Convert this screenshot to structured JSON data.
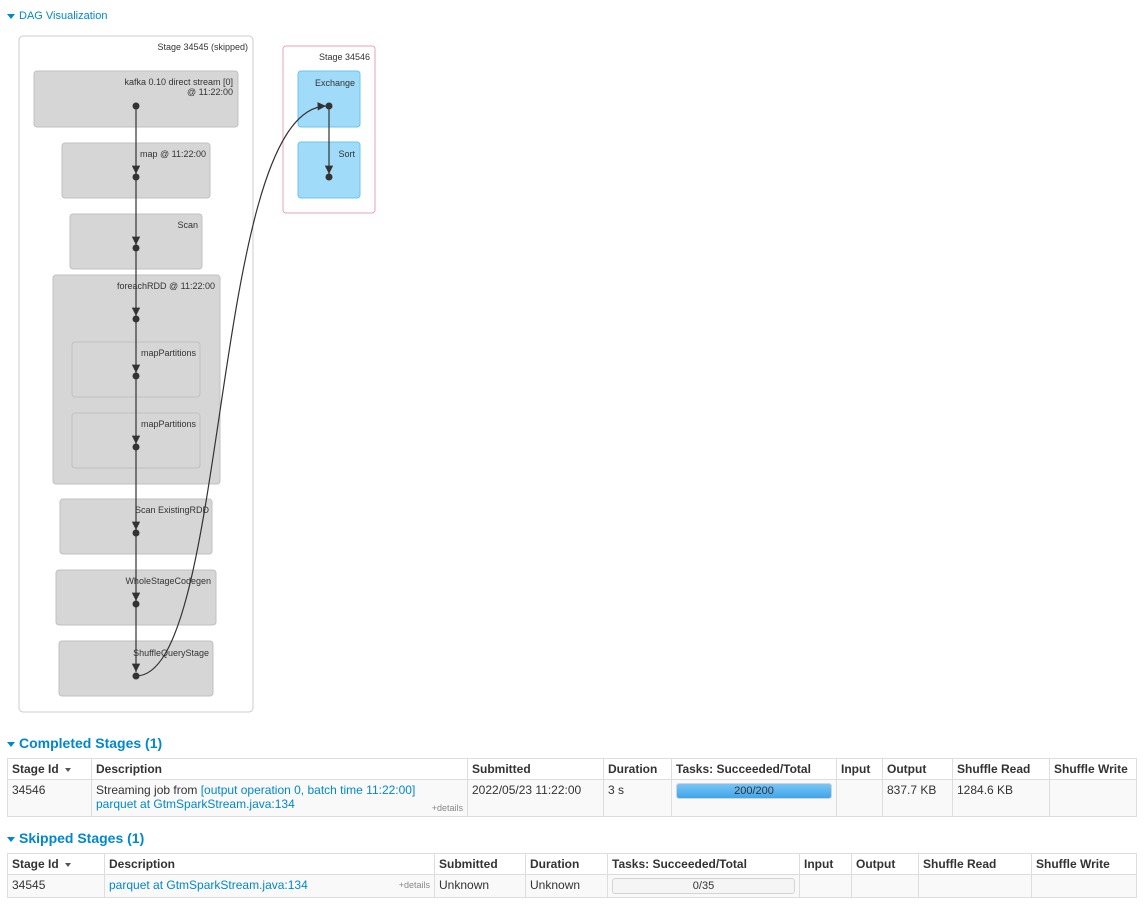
{
  "dag": {
    "toggle_label": "DAG Visualization",
    "stage_skipped": {
      "title": "Stage 34545 (skipped)",
      "nodes": [
        "kafka 0.10 direct stream [0]",
        "@ 11:22:00",
        "map @ 11:22:00",
        "Scan",
        "foreachRDD @ 11:22:00",
        "mapPartitions",
        "mapPartitions",
        "Scan ExistingRDD",
        "WholeStageCodegen",
        "ShuffleQueryStage"
      ]
    },
    "stage_active": {
      "title": "Stage 34546",
      "nodes": [
        "Exchange",
        "Sort"
      ]
    },
    "colors": {
      "skipped_fill": "#d6d6d6",
      "active_fill": "#a0dcfa",
      "active_border": "#e8a3b5",
      "edge": "#333333"
    }
  },
  "completed": {
    "title": "Completed Stages (1)",
    "headers": [
      "Stage Id",
      "Description",
      "Submitted",
      "Duration",
      "Tasks: Succeeded/Total",
      "Input",
      "Output",
      "Shuffle Read",
      "Shuffle Write"
    ],
    "rows": [
      {
        "stage_id": "34546",
        "desc_prefix": "Streaming job from ",
        "desc_link": "[output operation 0, batch time 11:22:00]",
        "desc_link2": "parquet at GtmSparkStream.java:134",
        "details": "+details",
        "submitted": "2022/05/23 11:22:00",
        "duration": "3 s",
        "tasks": "200/200",
        "tasks_fraction": 1.0,
        "input": "",
        "output": "837.7 KB",
        "shuffle_read": "1284.6 KB",
        "shuffle_write": ""
      }
    ]
  },
  "skipped": {
    "title": "Skipped Stages (1)",
    "headers": [
      "Stage Id",
      "Description",
      "Submitted",
      "Duration",
      "Tasks: Succeeded/Total",
      "Input",
      "Output",
      "Shuffle Read",
      "Shuffle Write"
    ],
    "rows": [
      {
        "stage_id": "34545",
        "desc_link": "parquet at GtmSparkStream.java:134",
        "details": "+details",
        "submitted": "Unknown",
        "duration": "Unknown",
        "tasks": "0/35",
        "tasks_fraction": 0.0,
        "input": "",
        "output": "",
        "shuffle_read": "",
        "shuffle_write": ""
      }
    ]
  }
}
